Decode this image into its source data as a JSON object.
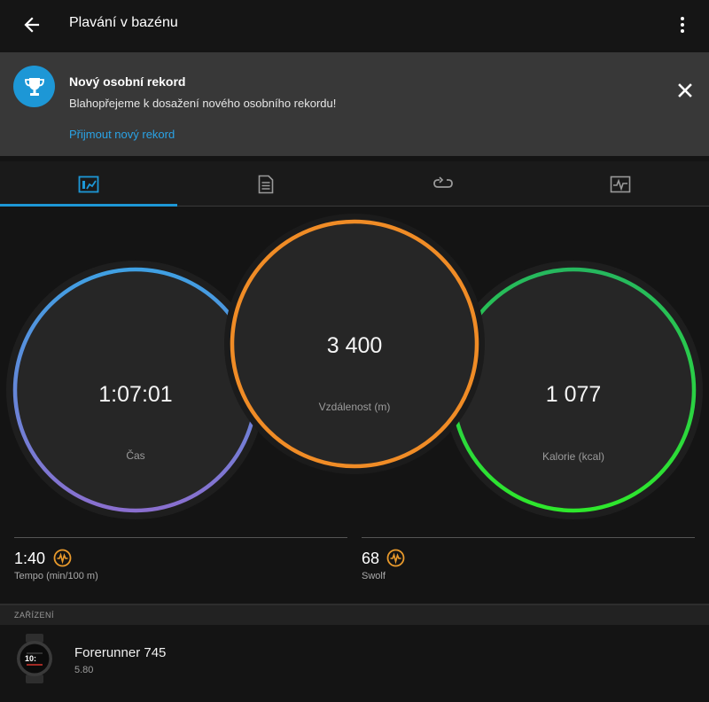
{
  "appbar": {
    "title": "Plavání v bazénu",
    "back_icon": "arrow-left-icon",
    "menu_icon": "more-vertical-icon"
  },
  "banner": {
    "icon": "trophy-icon",
    "title": "Nový osobní rekord",
    "text": "Blahopřejeme k dosažení nového osobního rekordu!",
    "link": "Přijmout nový rekord",
    "close_icon": "close-icon"
  },
  "tabs": [
    {
      "icon": "summary-chart-icon",
      "active": true
    },
    {
      "icon": "document-list-icon",
      "active": false
    },
    {
      "icon": "laps-loop-icon",
      "active": false
    },
    {
      "icon": "graph-icon",
      "active": false
    }
  ],
  "stats": {
    "time": {
      "value": "1:07:01",
      "label": "Čas"
    },
    "distance": {
      "value": "3 400",
      "label": "Vzdálenost (m)"
    },
    "calories": {
      "value": "1 077",
      "label": "Kalorie (kcal)"
    }
  },
  "metrics": {
    "pace": {
      "value": "1:40",
      "label": "Tempo (min/100 m)"
    },
    "swolf": {
      "value": "68",
      "label": "Swolf"
    }
  },
  "devices": {
    "section_label": "ZAŘÍZENÍ",
    "name": "Forerunner 745",
    "version": "5.80",
    "watch_text": "10:"
  },
  "colors": {
    "accent": "#1d97d6",
    "time_ring_top": "#3fa0e3",
    "time_ring_bottom": "#8a6fcf",
    "distance_ring": "#f08c26",
    "calories_ring_top": "#26b85e",
    "calories_ring_bottom": "#2ee82c",
    "metric_icon": "#e99a2c"
  }
}
